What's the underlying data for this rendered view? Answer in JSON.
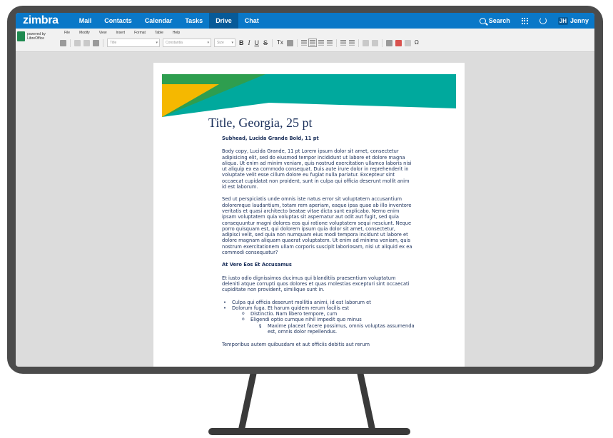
{
  "app": {
    "logo": "zimbra",
    "nav": [
      "Mail",
      "Contacts",
      "Calendar",
      "Tasks",
      "Drive",
      "Chat"
    ],
    "active_nav": "Drive",
    "search_label": "Search",
    "user_initials": "JH",
    "user_name": "Jenny"
  },
  "office": {
    "powered_line1": "powered by",
    "powered_line2": "LibreOffice",
    "menus": [
      "File",
      "Modify",
      "View",
      "Insert",
      "Format",
      "Table",
      "Help"
    ],
    "style_combo": "Title",
    "font_combo": "Constantia",
    "size_combo": "Size",
    "bold": "B",
    "italic": "I",
    "underline": "U",
    "strike": "S",
    "clear": "Tx",
    "special_char": "Ω"
  },
  "document": {
    "title": "Title, Georgia, 25 pt",
    "subhead": "Subhead, Lucida Grande Bold, 11 pt",
    "para1": "Body copy, Lucida Grande, 11 pt  Lorem ipsum dolor sit amet, consectetur adipisicing elit, sed do eiusmod tempor incididunt ut labore et dolore magna aliqua. Ut enim ad minim veniam, quis nostrud exercitation ullamco laboris nisi ut aliquip ex ea commodo consequat. Duis aute irure dolor in reprehenderit in voluptate velit esse cillum dolore eu fugiat nulla pariatur. Excepteur sint occaecat cupidatat non proident, sunt in culpa qui officia deserunt mollit anim id est laborum.",
    "para2": "Sed ut perspiciatis unde omnis iste natus error sit voluptatem accusantium doloremque laudantium, totam rem aperiam, eaque ipsa quae ab illo inventore veritatis et quasi architecto beatae vitae dicta sunt explicabo. Nemo enim ipsam voluptatem quia voluptas sit aspernatur aut odit aut fugit, sed quia consequuntur magni dolores eos qui ratione voluptatem sequi nesciunt. Neque porro quisquam est, qui dolorem ipsum quia dolor sit amet, consectetur, adipisci velit, sed quia non numquam eius modi tempora incidunt ut labore et dolore magnam aliquam quaerat voluptatem. Ut enim ad minima veniam, quis nostrum exercitationem ullam corporis suscipit laboriosam, nisi ut aliquid ex ea commodi consequatur?",
    "heading2": "At Vero Eos Et Accusamus",
    "para3": "Et iusto odio dignissimos ducimus qui blanditiis praesentium voluptatum deleniti atque corrupti quos dolores et quas molestias excepturi sint occaecati cupiditate non provident, similique sunt in.",
    "bullet1": "Culpa qui officia deserunt mollitia animi, id est laborum et",
    "bullet2": "Dolorum fuga. Et harum quidem rerum facilis est",
    "sub1": "Distinctio. Nam libero tempore, cum",
    "sub2": "Eligendi optio cumque nihil impedit quo minus",
    "subsub1": "Maxime placeat facere possimus, omnis voluptas assumenda est, omnis dolor repellendus.",
    "tail": "Temporibus autem quibusdam et aut officiis debitis aut rerum"
  },
  "colors": {
    "nav_bg": "#0a78c8",
    "nav_active": "#075a98",
    "banner_teal": "#00a99d",
    "banner_green": "#2e9e4f",
    "banner_yellow": "#f5b800",
    "text_navy": "#1a2f5a"
  }
}
